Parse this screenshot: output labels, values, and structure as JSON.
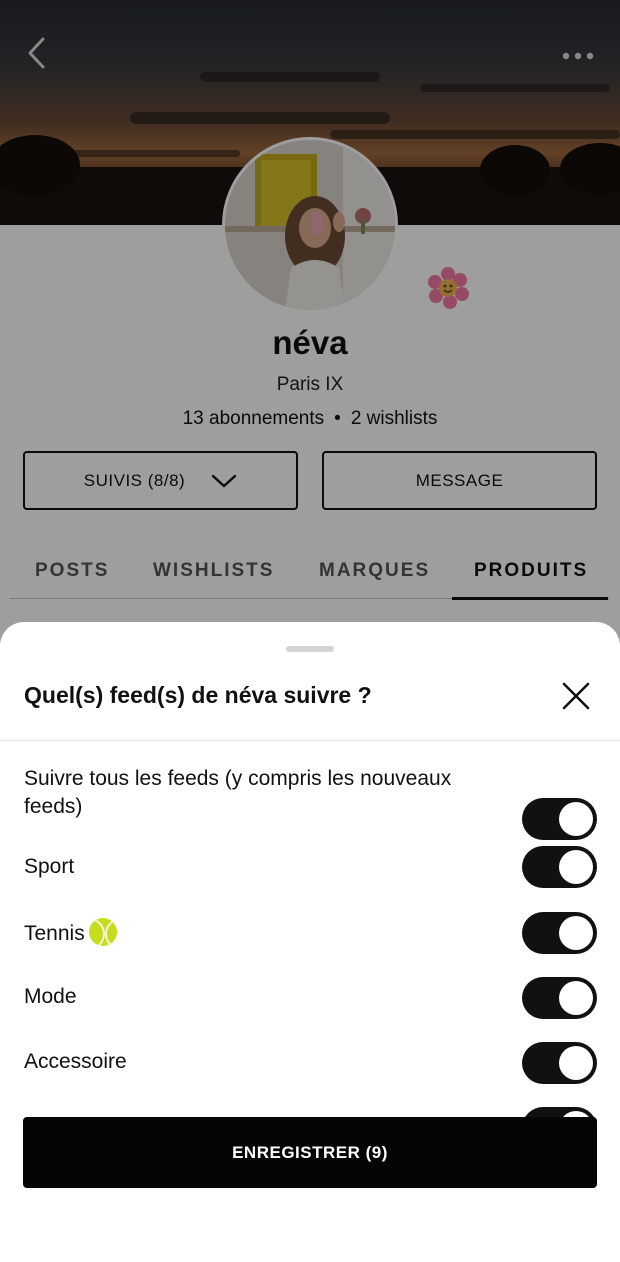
{
  "profile": {
    "name": "néva",
    "location": "Paris IX",
    "subscriptions": "13 abonnements",
    "separator": "•",
    "wishlists": "2 wishlists",
    "follow_button": "SUIVIS (8/8)",
    "message_button": "MESSAGE",
    "tabs": [
      "POSTS",
      "WISHLISTS",
      "MARQUES",
      "PRODUITS"
    ],
    "active_tab": "PRODUITS"
  },
  "icons": {
    "back": "chevron-left-icon",
    "more": "more-horizontal-icon",
    "dropdown": "chevron-down-icon",
    "badge": "flower-icon",
    "close": "close-icon",
    "tennis": "tennis-ball-icon"
  },
  "sheet": {
    "title": "Quel(s) feed(s) de néva suivre ?",
    "feeds": [
      {
        "label": "Suivre tous les feeds (y compris les nouveaux feeds)",
        "enabled": true
      },
      {
        "label": "Sport",
        "enabled": true
      },
      {
        "label": "Tennis",
        "enabled": true
      },
      {
        "label": "Mode",
        "enabled": true
      },
      {
        "label": "Accessoire",
        "enabled": true
      }
    ],
    "save_button": "ENREGISTRER (9)"
  },
  "colors": {
    "toggle_on": "#111111",
    "primary_button": "#050505",
    "overlay": "rgba(0,0,0,0.38)"
  }
}
